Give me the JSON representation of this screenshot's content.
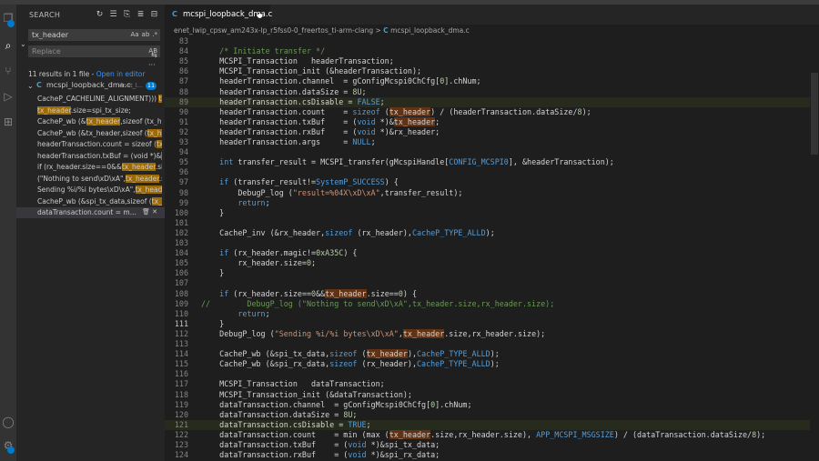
{
  "sidebar": {
    "title": "SEARCH",
    "search_value": "tx_header",
    "replace_placeholder": "Replace",
    "search_opts": [
      "Aa",
      "ab",
      ".*"
    ],
    "replace_opts": "AB",
    "summary_text": "11 results in 1 file - ",
    "open_in_editor": "Open in editor",
    "file": {
      "icon": "C",
      "name": "mcspi_loopback_dma.c",
      "path": "enet_l...",
      "count": "11"
    },
    "matches": [
      {
        "pre": "CacheP_CACHELINE_ALIGNMENT))) ",
        "hit": "tx_...",
        "post": ""
      },
      {
        "pre": "",
        "hit": "tx_header",
        "post": ".size=spi_tx_size;"
      },
      {
        "pre": "CacheP_wb (&",
        "hit": "tx_header",
        "post": ",sizeof (tx_he..."
      },
      {
        "pre": "CacheP_wb (&tx_header,sizeof (",
        "hit": "tx_he...",
        "post": ""
      },
      {
        "pre": "headerTransaction.count   = sizeof (",
        "hit": "tx_...",
        "post": ""
      },
      {
        "pre": "headerTransaction.txBuf   = (void *)&",
        "hit": "tx...",
        "post": ""
      },
      {
        "pre": "if (rx_header.size==0&&",
        "hit": "tx_header",
        "post": ".size..."
      },
      {
        "pre": "(\"Nothing to send\\xD\\xA\",",
        "hit": "tx_header",
        "post": ".si..."
      },
      {
        "pre": "Sending %i/%i bytes\\xD\\xA\",",
        "hit": "tx_heade...",
        "post": ""
      },
      {
        "pre": "CacheP_wb (&spi_tx_data,sizeof (",
        "hit": "tx_h...",
        "post": ""
      },
      {
        "pre": "dataTransaction.count   = m...",
        "hit": "",
        "post": ""
      }
    ]
  },
  "editor": {
    "tab_icon": "C",
    "tab_label": "mcspi_loopback_dma.c",
    "breadcrumb_path": "enet_lwip_cpsw_am243x-lp_r5fss0-0_freertos_ti-arm-clang",
    "breadcrumb_sep": ">",
    "breadcrumb_icon": "C",
    "breadcrumb_file": "mcspi_loopback_dma.c",
    "lines": [
      {
        "n": "83",
        "t": ""
      },
      {
        "n": "84",
        "t": "    /* Initiate transfer */"
      },
      {
        "n": "85",
        "t": "    MCSPI_Transaction   headerTransaction;"
      },
      {
        "n": "86",
        "t": "    MCSPI_Transaction_init (&headerTransaction);"
      },
      {
        "n": "87",
        "t": "    headerTransaction.channel  = gConfigMcspi0ChCfg[0].chNum;"
      },
      {
        "n": "88",
        "t": "    headerTransaction.dataSize = 8U;"
      },
      {
        "n": "89",
        "t": "    headerTransaction.csDisable = FALSE;"
      },
      {
        "n": "90",
        "t": "    headerTransaction.count    = sizeof (|tx_header|) / (headerTransaction.dataSize/8);"
      },
      {
        "n": "91",
        "t": "    headerTransaction.txBuf    = (void *)&|tx_header|;"
      },
      {
        "n": "92",
        "t": "    headerTransaction.rxBuf    = (void *)&rx_header;"
      },
      {
        "n": "93",
        "t": "    headerTransaction.args     = NULL;"
      },
      {
        "n": "94",
        "t": ""
      },
      {
        "n": "95",
        "t": "    int transfer_result = MCSPI_transfer(gMcspiHandle[CONFIG_MCSPI0], &headerTransaction);"
      },
      {
        "n": "96",
        "t": ""
      },
      {
        "n": "97",
        "t": "    if (transfer_result!=SystemP_SUCCESS) {"
      },
      {
        "n": "98",
        "t": "        DebugP_log (\"result=%04X\\xD\\xA\",transfer_result);"
      },
      {
        "n": "99",
        "t": "        return;"
      },
      {
        "n": "100",
        "t": "    }"
      },
      {
        "n": "101",
        "t": ""
      },
      {
        "n": "102",
        "t": "    CacheP_inv (&rx_header,sizeof (rx_header),CacheP_TYPE_ALLD);"
      },
      {
        "n": "103",
        "t": ""
      },
      {
        "n": "104",
        "t": "    if (rx_header.magic!=0xA35C) {"
      },
      {
        "n": "105",
        "t": "        rx_header.size=0;"
      },
      {
        "n": "106",
        "t": "    }"
      },
      {
        "n": "107",
        "t": ""
      },
      {
        "n": "108",
        "t": "    if (rx_header.size==0&&|tx_header|.size==0) {"
      },
      {
        "n": "109",
        "t": "//        DebugP_log (\"Nothing to send\\xD\\xA\",|tx_header|.size,rx_header.size);"
      },
      {
        "n": "110",
        "t": "        return;"
      },
      {
        "n": "111",
        "t": "    }"
      },
      {
        "n": "112",
        "t": "    DebugP_log (\"Sending %i/%i bytes\\xD\\xA\",|tx_header|.size,rx_header.size);"
      },
      {
        "n": "113",
        "t": ""
      },
      {
        "n": "114",
        "t": "    CacheP_wb (&spi_tx_data,sizeof (|tx_header|),CacheP_TYPE_ALLD);"
      },
      {
        "n": "115",
        "t": "    CacheP_wb (&spi_rx_data,sizeof (rx_header),CacheP_TYPE_ALLD);"
      },
      {
        "n": "116",
        "t": ""
      },
      {
        "n": "117",
        "t": "    MCSPI_Transaction   dataTransaction;"
      },
      {
        "n": "118",
        "t": "    MCSPI_Transaction_init (&dataTransaction);"
      },
      {
        "n": "119",
        "t": "    dataTransaction.channel  = gConfigMcspi0ChCfg[0].chNum;"
      },
      {
        "n": "120",
        "t": "    dataTransaction.dataSize = 8U;"
      },
      {
        "n": "121",
        "t": "    dataTransaction.csDisable = TRUE;"
      },
      {
        "n": "122",
        "t": "    dataTransaction.count    = min (max (|tx_header|.size,rx_header.size), APP_MCSPI_MSGSIZE) / (dataTransaction.dataSize/8);"
      },
      {
        "n": "123",
        "t": "    dataTransaction.txBuf    = (void *)&spi_tx_data;"
      },
      {
        "n": "124",
        "t": "    dataTransaction.rxBuf    = (void *)&spi_rx_data;"
      }
    ],
    "current_line": "111",
    "highlight_lines": [
      "89",
      "121"
    ]
  }
}
